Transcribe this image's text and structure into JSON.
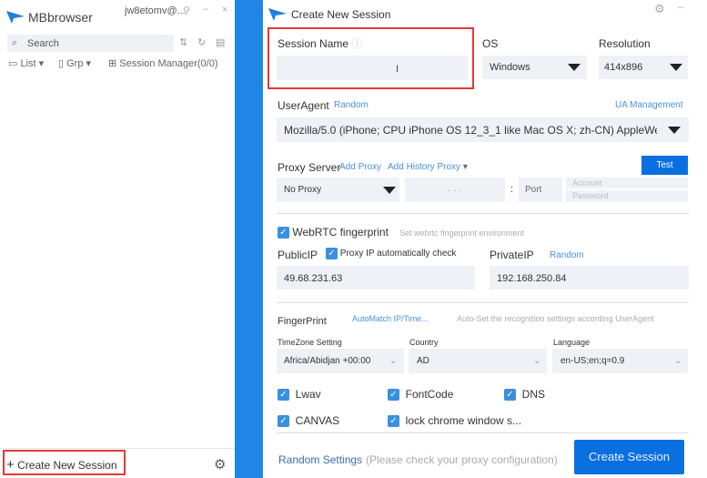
{
  "left": {
    "app_title": "MBbrowser",
    "account": "jw8etomv@...",
    "search_placeholder": "Search",
    "list": "List",
    "grp": "Grp",
    "session_manager": "Session Manager(0/0)",
    "create": "Create New Session"
  },
  "dialog": {
    "title": "Create New Session",
    "session_name_label": "Session Name",
    "session_name_value": "",
    "os_label": "OS",
    "os_value": "Windows",
    "resolution_label": "Resolution",
    "resolution_value": "414x896",
    "useragent_label": "UserAgent",
    "random": "Random",
    "ua_management": "UA Management",
    "ua_value": "Mozilla/5.0 (iPhone; CPU iPhone OS 12_3_1 like Mac OS X; zh-CN) AppleWebKit/5",
    "proxy_label": "Proxy Server",
    "add_proxy": "Add Proxy",
    "add_history_proxy": "Add History Proxy",
    "test": "Test",
    "proxy_value": "No Proxy",
    "ip_placeholder": ".   .   .",
    "port": "Port",
    "account": "Account",
    "password": "Password",
    "webrtc": "WebRTC fingerprint",
    "webrtc_hint": "Set webrtc fingerprint environment",
    "public_ip_label": "PublicIP",
    "proxy_ip_check": "Proxy IP automatically check",
    "public_ip": "49.68.231.63",
    "private_ip_label": "PrivateIP",
    "private_random": "Random",
    "private_ip": "192.168.250.84",
    "fingerprint": "FingerPrint",
    "automatch": "AutoMatch IP/Time...",
    "autoset_hint": "Auto-Set the recognition settings according UserAgent",
    "timezone_label": "TimeZone Setting",
    "timezone": "Africa/Abidjan +00:00",
    "country_label": "Country",
    "country": "AD",
    "language_label": "Language",
    "language": "en-US;en;q=0.9",
    "checks": [
      "Lwav",
      "FontCode",
      "DNS",
      "CANVAS",
      "lock chrome window s..."
    ],
    "random_settings": "Random Settings",
    "proxy_hint": "(Please check your proxy configuration)",
    "create_session": "Create Session"
  },
  "colors": {
    "accent": "#0a6fe0",
    "background": "#1f86e6",
    "highlight": "#e53935"
  }
}
